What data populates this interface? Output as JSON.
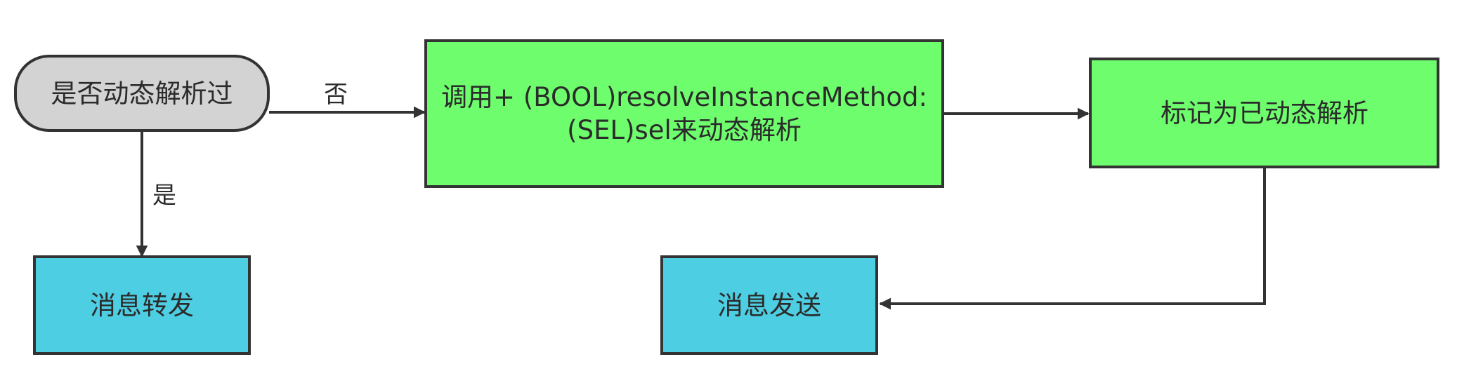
{
  "diagram": {
    "nodes": {
      "start": {
        "label": "是否动态解析过",
        "shape": "rounded",
        "color": "#d3d3d3"
      },
      "resolve": {
        "line1": "调用+ (BOOL)resolveInstanceMethod:",
        "line2": "(SEL)sel来动态解析",
        "shape": "rect",
        "color": "#6efd6d"
      },
      "mark": {
        "label": "标记为已动态解析",
        "shape": "rect",
        "color": "#6efd6d"
      },
      "forward": {
        "label": "消息转发",
        "shape": "rect",
        "color": "#4ecee2"
      },
      "send": {
        "label": "消息发送",
        "shape": "rect",
        "color": "#4ecee2"
      }
    },
    "edges": {
      "no_label": "否",
      "yes_label": "是"
    },
    "stroke_color": "#333333"
  }
}
